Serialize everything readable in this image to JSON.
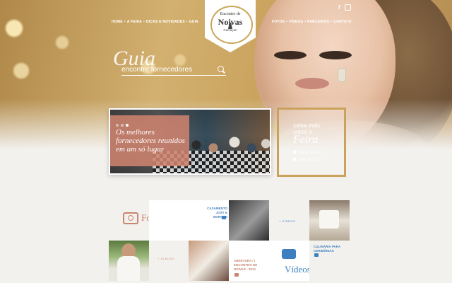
{
  "nav": {
    "left": [
      "HOME",
      "A FEIRA",
      "DICAS E NOVIDADES",
      "GUIA"
    ],
    "right": [
      "FOTOS",
      "VÍDEOS",
      "PARCEIROS",
      "CONTATO"
    ],
    "separator": "•"
  },
  "social": {
    "facebook": "f",
    "instagram": "instagram-icon"
  },
  "logo": {
    "top": "Encontro de",
    "main": "Noivas",
    "sub": "Camaçari"
  },
  "guia": {
    "title": "Guia",
    "placeholder": "encontre fornecedores"
  },
  "slide": {
    "caption": "Os melhores fornecedores reunidos em um só lugar"
  },
  "feira": {
    "saiba": "saiba mais sobre a",
    "name": "Feira",
    "location": "Camaçari-Ba",
    "date": "maio de 2015"
  },
  "grid": {
    "fotos_label": "Fotos",
    "casamento": "CASAMENTO JOSY & MARCOS",
    "videos_tag": "+ VÍDEOS",
    "albuns_tag": "+ ÁLBUNS",
    "culinaria": "CULINÁRIA PARA CERIMÔNIAS",
    "abertura": "ABERTURA / I ENCONTRO DE NOIVAS - 2014",
    "videos_label": "Vídeos"
  },
  "colors": {
    "accent": "#c9a25c",
    "coral": "#cd826e",
    "blue": "#3d7fbf"
  }
}
